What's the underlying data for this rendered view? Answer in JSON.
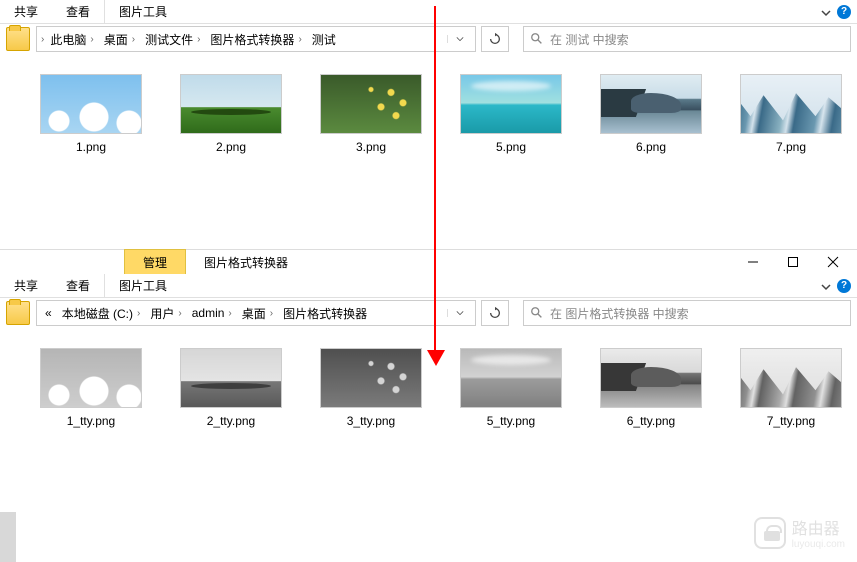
{
  "top": {
    "ribbon": {
      "share": "共享",
      "view": "查看",
      "tool": "图片工具"
    },
    "breadcrumb": [
      "此电脑",
      "桌面",
      "测试文件",
      "图片格式转换器",
      "测试"
    ],
    "search_placeholder": "在 测试 中搜索",
    "files": [
      {
        "name": "1.png"
      },
      {
        "name": "2.png"
      },
      {
        "name": "3.png"
      },
      {
        "name": "5.png"
      },
      {
        "name": "6.png"
      },
      {
        "name": "7.png"
      }
    ]
  },
  "bottom": {
    "title_tab": "管理",
    "title": "图片格式转换器",
    "ribbon": {
      "share": "共享",
      "view": "查看",
      "tool": "图片工具"
    },
    "breadcrumb_prefix": "«",
    "breadcrumb": [
      "本地磁盘 (C:)",
      "用户",
      "admin",
      "桌面",
      "图片格式转换器"
    ],
    "search_placeholder": "在 图片格式转换器 中搜索",
    "files": [
      {
        "name": "1_tty.png"
      },
      {
        "name": "2_tty.png"
      },
      {
        "name": "3_tty.png"
      },
      {
        "name": "5_tty.png"
      },
      {
        "name": "6_tty.png"
      },
      {
        "name": "7_tty.png"
      }
    ]
  },
  "watermark": {
    "text": "路由器",
    "sub": "luyouqi.com"
  }
}
